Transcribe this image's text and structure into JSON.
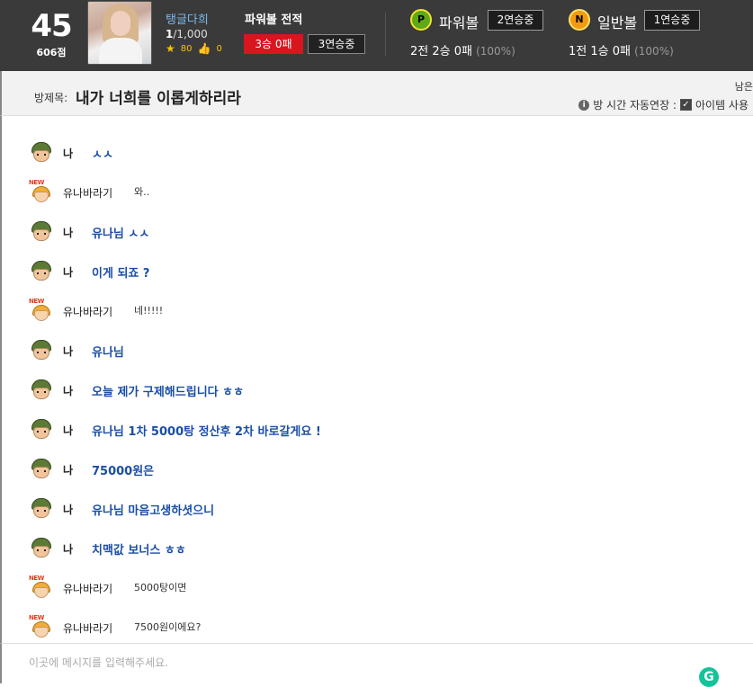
{
  "header": {
    "level": "45",
    "points": "606점",
    "user_name": "탱글다희",
    "count_current": "1",
    "count_total": "/1,000",
    "stars": "80",
    "likes": "0",
    "record_title": "파워볼 전적",
    "record_result": "3승 0패",
    "record_streak": "3연승중",
    "powerball": {
      "ball_letter": "P",
      "label": "파워볼",
      "streak": "2연승중",
      "result": "2전 2승 0패",
      "percent": "(100%)"
    },
    "normalball": {
      "ball_letter": "N",
      "label": "일반볼",
      "streak": "1연승중",
      "result": "1전 1승 0패",
      "percent": "(100%)"
    }
  },
  "room": {
    "label": "방제목:",
    "title": "내가 너희를 이롭게하리라",
    "right_text": "남은",
    "time_ext_label": "방 시간 자동연장 :",
    "item_label": "아이템 사용"
  },
  "messages": [
    {
      "type": "me",
      "nick": "나",
      "text": "ㅅㅅ",
      "avatar": "soldier"
    },
    {
      "type": "other",
      "nick": "유나바라기",
      "text": "와..",
      "avatar": "newbie"
    },
    {
      "type": "me",
      "nick": "나",
      "text": "유나님 ㅅㅅ",
      "avatar": "soldier"
    },
    {
      "type": "me",
      "nick": "나",
      "text": "이게 되죠 ?",
      "avatar": "soldier"
    },
    {
      "type": "other",
      "nick": "유나바라기",
      "text": "네!!!!!",
      "avatar": "newbie"
    },
    {
      "type": "me",
      "nick": "나",
      "text": "유나님",
      "avatar": "soldier"
    },
    {
      "type": "me",
      "nick": "나",
      "text": "오늘 제가 구제해드립니다 ㅎㅎ",
      "avatar": "soldier"
    },
    {
      "type": "me",
      "nick": "나",
      "text": "유나님 1차 5000탕 정산후 2차 바로갈게요 !",
      "avatar": "soldier"
    },
    {
      "type": "me",
      "nick": "나",
      "text": "75000원은",
      "avatar": "soldier"
    },
    {
      "type": "me",
      "nick": "나",
      "text": "유나님 마음고생하셧으니",
      "avatar": "soldier"
    },
    {
      "type": "me",
      "nick": "나",
      "text": "치맥값 보너스 ㅎㅎ",
      "avatar": "soldier"
    },
    {
      "type": "other",
      "nick": "유나바라기",
      "text": "5000탕이면",
      "avatar": "newbie"
    },
    {
      "type": "other",
      "nick": "유나바라기",
      "text": "7500원이에요?",
      "avatar": "newbie"
    }
  ],
  "avatar_new_tag": "NEW",
  "input": {
    "placeholder": "이곳에 메시지를 입력해주세요.",
    "value": ""
  },
  "grammarly_letter": "G",
  "colors": {
    "topbar": "#3a3a3a",
    "my_message": "#1a4ea6",
    "win_badge": "#d7161e",
    "powerball": "#5fa817",
    "normalball": "#f29a12"
  }
}
